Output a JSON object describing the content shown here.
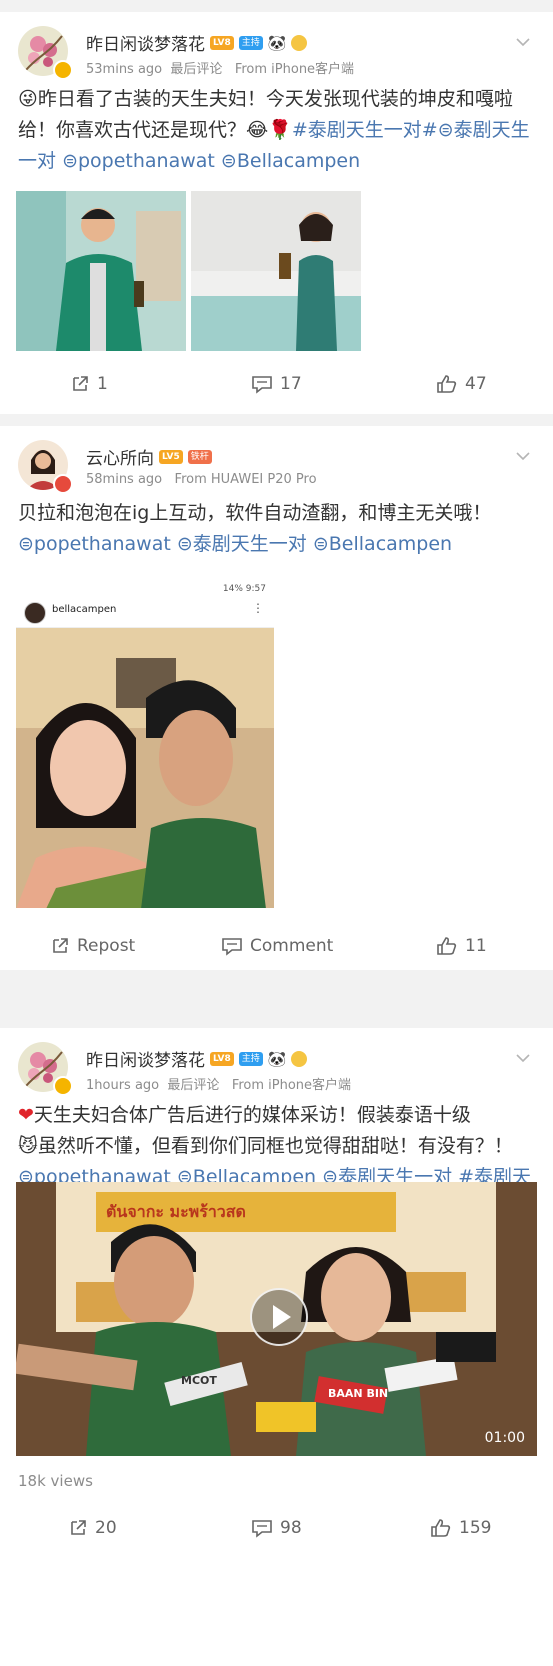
{
  "posts": [
    {
      "author": "昨日闲谈梦落花",
      "level": "LV8",
      "role": "主持",
      "time": "53mins ago",
      "comment_tag": "最后评论",
      "source": "From iPhone客户端",
      "text_plain": "昨日看了古装的天生夫妇！今天发张现代装的坤皮和嘎啦给！你喜欢古代还是现代？",
      "tags": [
        "#泰剧天生一对#",
        "泰剧天生一对",
        "popethanawat",
        "Bellacampen"
      ],
      "stats": {
        "repost": "1",
        "comment": "17",
        "like": "47"
      }
    },
    {
      "author": "云心所向",
      "level": "LV5",
      "role": "铁杆",
      "time": "58mins ago",
      "source": "From HUAWEI P20 Pro",
      "text_plain": "贝拉和泡泡在ig上互动，软件自动渣翻，和博主无关哦！",
      "tags": [
        "popethanawat",
        "泰剧天生一对",
        "Bellacampen"
      ],
      "ig": {
        "user": "bellacampen",
        "status": "14% 9:57"
      },
      "stats": {
        "repost": "Repost",
        "comment": "Comment",
        "like": "11"
      }
    },
    {
      "author": "昨日闲谈梦落花",
      "level": "LV8",
      "role": "主持",
      "time": "1hours ago",
      "comment_tag": "最后评论",
      "source": "From iPhone客户端",
      "text_plain_a": "天生夫妇合体广告后进行的媒体采访！假装泰语十级",
      "text_plain_b": "虽然听不懂，但看到你们同框也觉得甜甜哒！有没有？！",
      "tags": [
        "popethanawat",
        "Bellacampen",
        "泰剧天生一对",
        "#泰剧天生一对#"
      ],
      "video": {
        "duration": "01:00",
        "views": "18k views",
        "sign_text": "ตันจากะ มะพร้าวสด",
        "mic_labels": [
          "BAAN BIN",
          "MCOT"
        ]
      },
      "stats": {
        "repost": "20",
        "comment": "98",
        "like": "159"
      }
    }
  ],
  "colors": {
    "link": "#4a77b0",
    "level": "#f6a623",
    "role_host": "#2f9ef0",
    "role_fan": "#f0704a",
    "background": "#f2f2f2"
  }
}
